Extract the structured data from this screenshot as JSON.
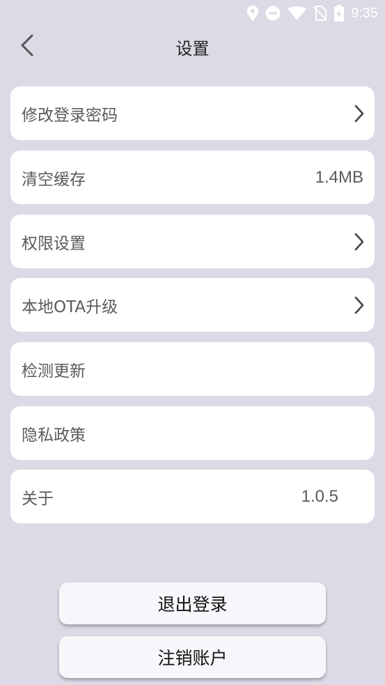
{
  "status_bar": {
    "time": "9:35",
    "icons": [
      "location-pin-icon",
      "do-not-disturb-icon",
      "wifi-icon",
      "no-sim-icon",
      "battery-charging-icon"
    ]
  },
  "header": {
    "back_icon": "chevron-left-icon",
    "title": "设置"
  },
  "settings": {
    "change_password": {
      "label": "修改登录密码",
      "icon": "chevron-right-icon"
    },
    "clear_cache": {
      "label": "清空缓存",
      "value": "1.4MB"
    },
    "permissions": {
      "label": "权限设置",
      "icon": "chevron-right-icon"
    },
    "local_ota": {
      "label": "本地OTA升级",
      "icon": "chevron-right-icon"
    },
    "check_update": {
      "label": "检测更新"
    },
    "privacy_policy": {
      "label": "隐私政策"
    },
    "about": {
      "label": "关于",
      "value": "1.0.5"
    }
  },
  "actions": {
    "logout_label": "退出登录",
    "delete_account_label": "注销账户"
  },
  "colors": {
    "background": "#dcdae5",
    "card": "#ffffff",
    "text": "#5a5a5a",
    "title": "#222222"
  }
}
